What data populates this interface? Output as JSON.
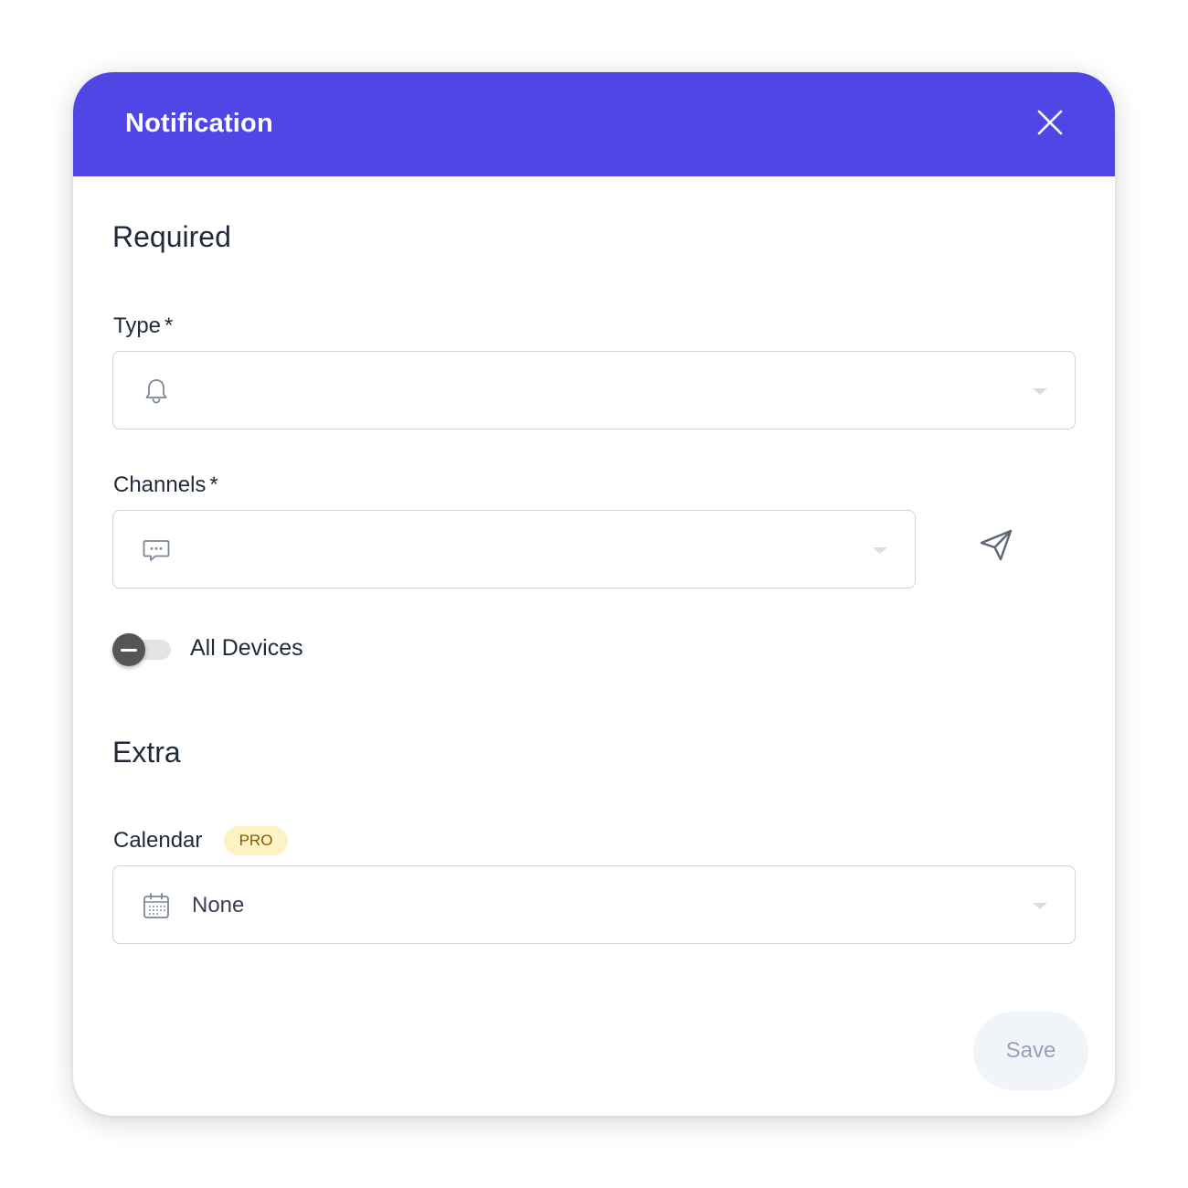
{
  "dialog": {
    "title": "Notification",
    "accent_color": "#5046e5",
    "close_icon": "close-icon"
  },
  "sections": {
    "required": {
      "title": "Required"
    },
    "extra": {
      "title": "Extra"
    }
  },
  "fields": {
    "type": {
      "label": "Type",
      "required_mark": "*",
      "icon": "bell-icon",
      "value": ""
    },
    "channels": {
      "label": "Channels",
      "required_mark": "*",
      "icon": "chat-bubble-icon",
      "value": "",
      "action_icon": "send-icon"
    },
    "all_devices": {
      "label": "All Devices",
      "state": "indeterminate"
    },
    "calendar": {
      "label": "Calendar",
      "badge": "PRO",
      "icon": "calendar-icon",
      "value": "None"
    }
  },
  "footer": {
    "save_label": "Save"
  }
}
